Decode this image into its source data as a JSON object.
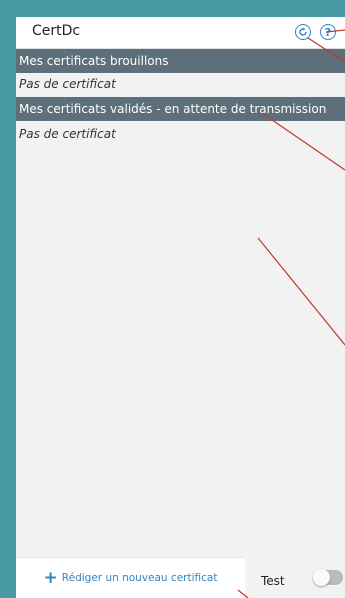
{
  "app": {
    "title": "CertDc"
  },
  "header_icons": {
    "refresh": "refresh-icon",
    "help": "help-icon",
    "help_glyph": "?"
  },
  "sections": [
    {
      "title": "Mes certificats brouillons",
      "empty_text": "Pas de certificat"
    },
    {
      "title": "Mes certificats validés - en attente de transmission",
      "empty_text": "Pas de certificat"
    }
  ],
  "footer": {
    "new_certificate_label": "Rédiger un nouveau certificat",
    "test_label": "Test",
    "test_enabled": false
  },
  "colors": {
    "accent": "#2f86c6",
    "section_header_bg": "#5e6f7c",
    "frame": "#4a9aa3",
    "annotation_lines": "#c0392b"
  }
}
